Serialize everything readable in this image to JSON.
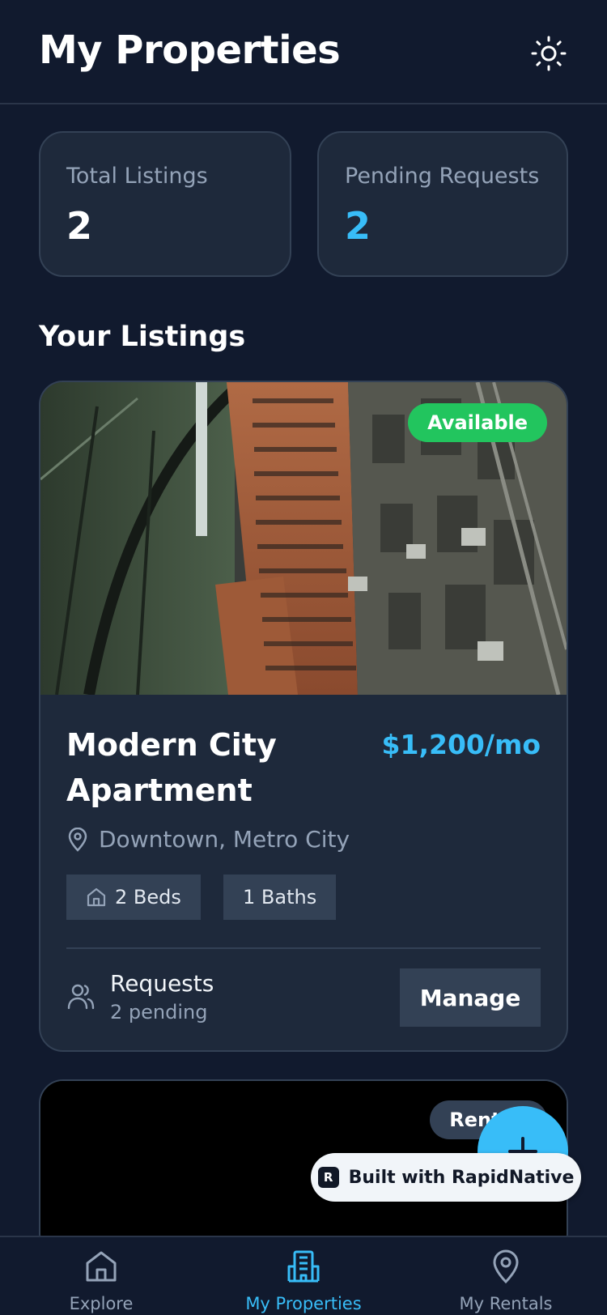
{
  "header": {
    "title": "My Properties",
    "theme_icon": "sun-icon"
  },
  "stats": [
    {
      "label": "Total Listings",
      "value": "2",
      "color": "#ffffff"
    },
    {
      "label": "Pending Requests",
      "value": "2",
      "color": "#38bdf8"
    }
  ],
  "section_title": "Your Listings",
  "listings": [
    {
      "status": "Available",
      "status_color": "#22c55e",
      "title": "Modern City Apartment",
      "price": "$1,200/mo",
      "location": "Downtown, Metro City",
      "beds": "2 Beds",
      "baths": "1 Baths",
      "requests_label": "Requests",
      "requests_sub": "2 pending",
      "action": "Manage"
    },
    {
      "status": "Rented"
    }
  ],
  "fab_icon": "plus-icon",
  "built_with": "Built with RapidNative",
  "tabs": [
    {
      "label": "Explore",
      "icon": "home-icon",
      "active": false
    },
    {
      "label": "My Properties",
      "icon": "building-icon",
      "active": true
    },
    {
      "label": "My Rentals",
      "icon": "map-pin-icon",
      "active": false
    }
  ],
  "colors": {
    "background": "#111a2e",
    "card": "#1e293b",
    "accent": "#38bdf8",
    "success": "#22c55e"
  }
}
